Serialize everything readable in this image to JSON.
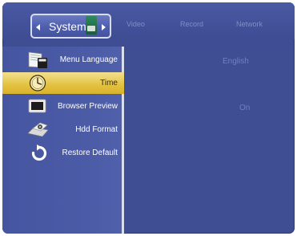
{
  "tabs": {
    "active": "System",
    "others": [
      "Video",
      "Record",
      "Network"
    ]
  },
  "menu": {
    "items": [
      {
        "label": "Menu Language",
        "icon": "language-book-icon",
        "value": "English",
        "selected": false
      },
      {
        "label": "Time",
        "icon": "clock-icon",
        "value": "",
        "selected": true
      },
      {
        "label": "Browser Preview",
        "icon": "monitor-icon",
        "value": "On",
        "selected": false
      },
      {
        "label": "Hdd Format",
        "icon": "hdd-format-icon",
        "value": "",
        "selected": false
      },
      {
        "label": "Restore Default",
        "icon": "restore-icon",
        "value": "",
        "selected": false
      }
    ]
  },
  "colors": {
    "background": "#3f4e93",
    "selected_bar": "#e3c140",
    "value_text": "#6f7fbf",
    "tab_border": "#d8dcef"
  }
}
